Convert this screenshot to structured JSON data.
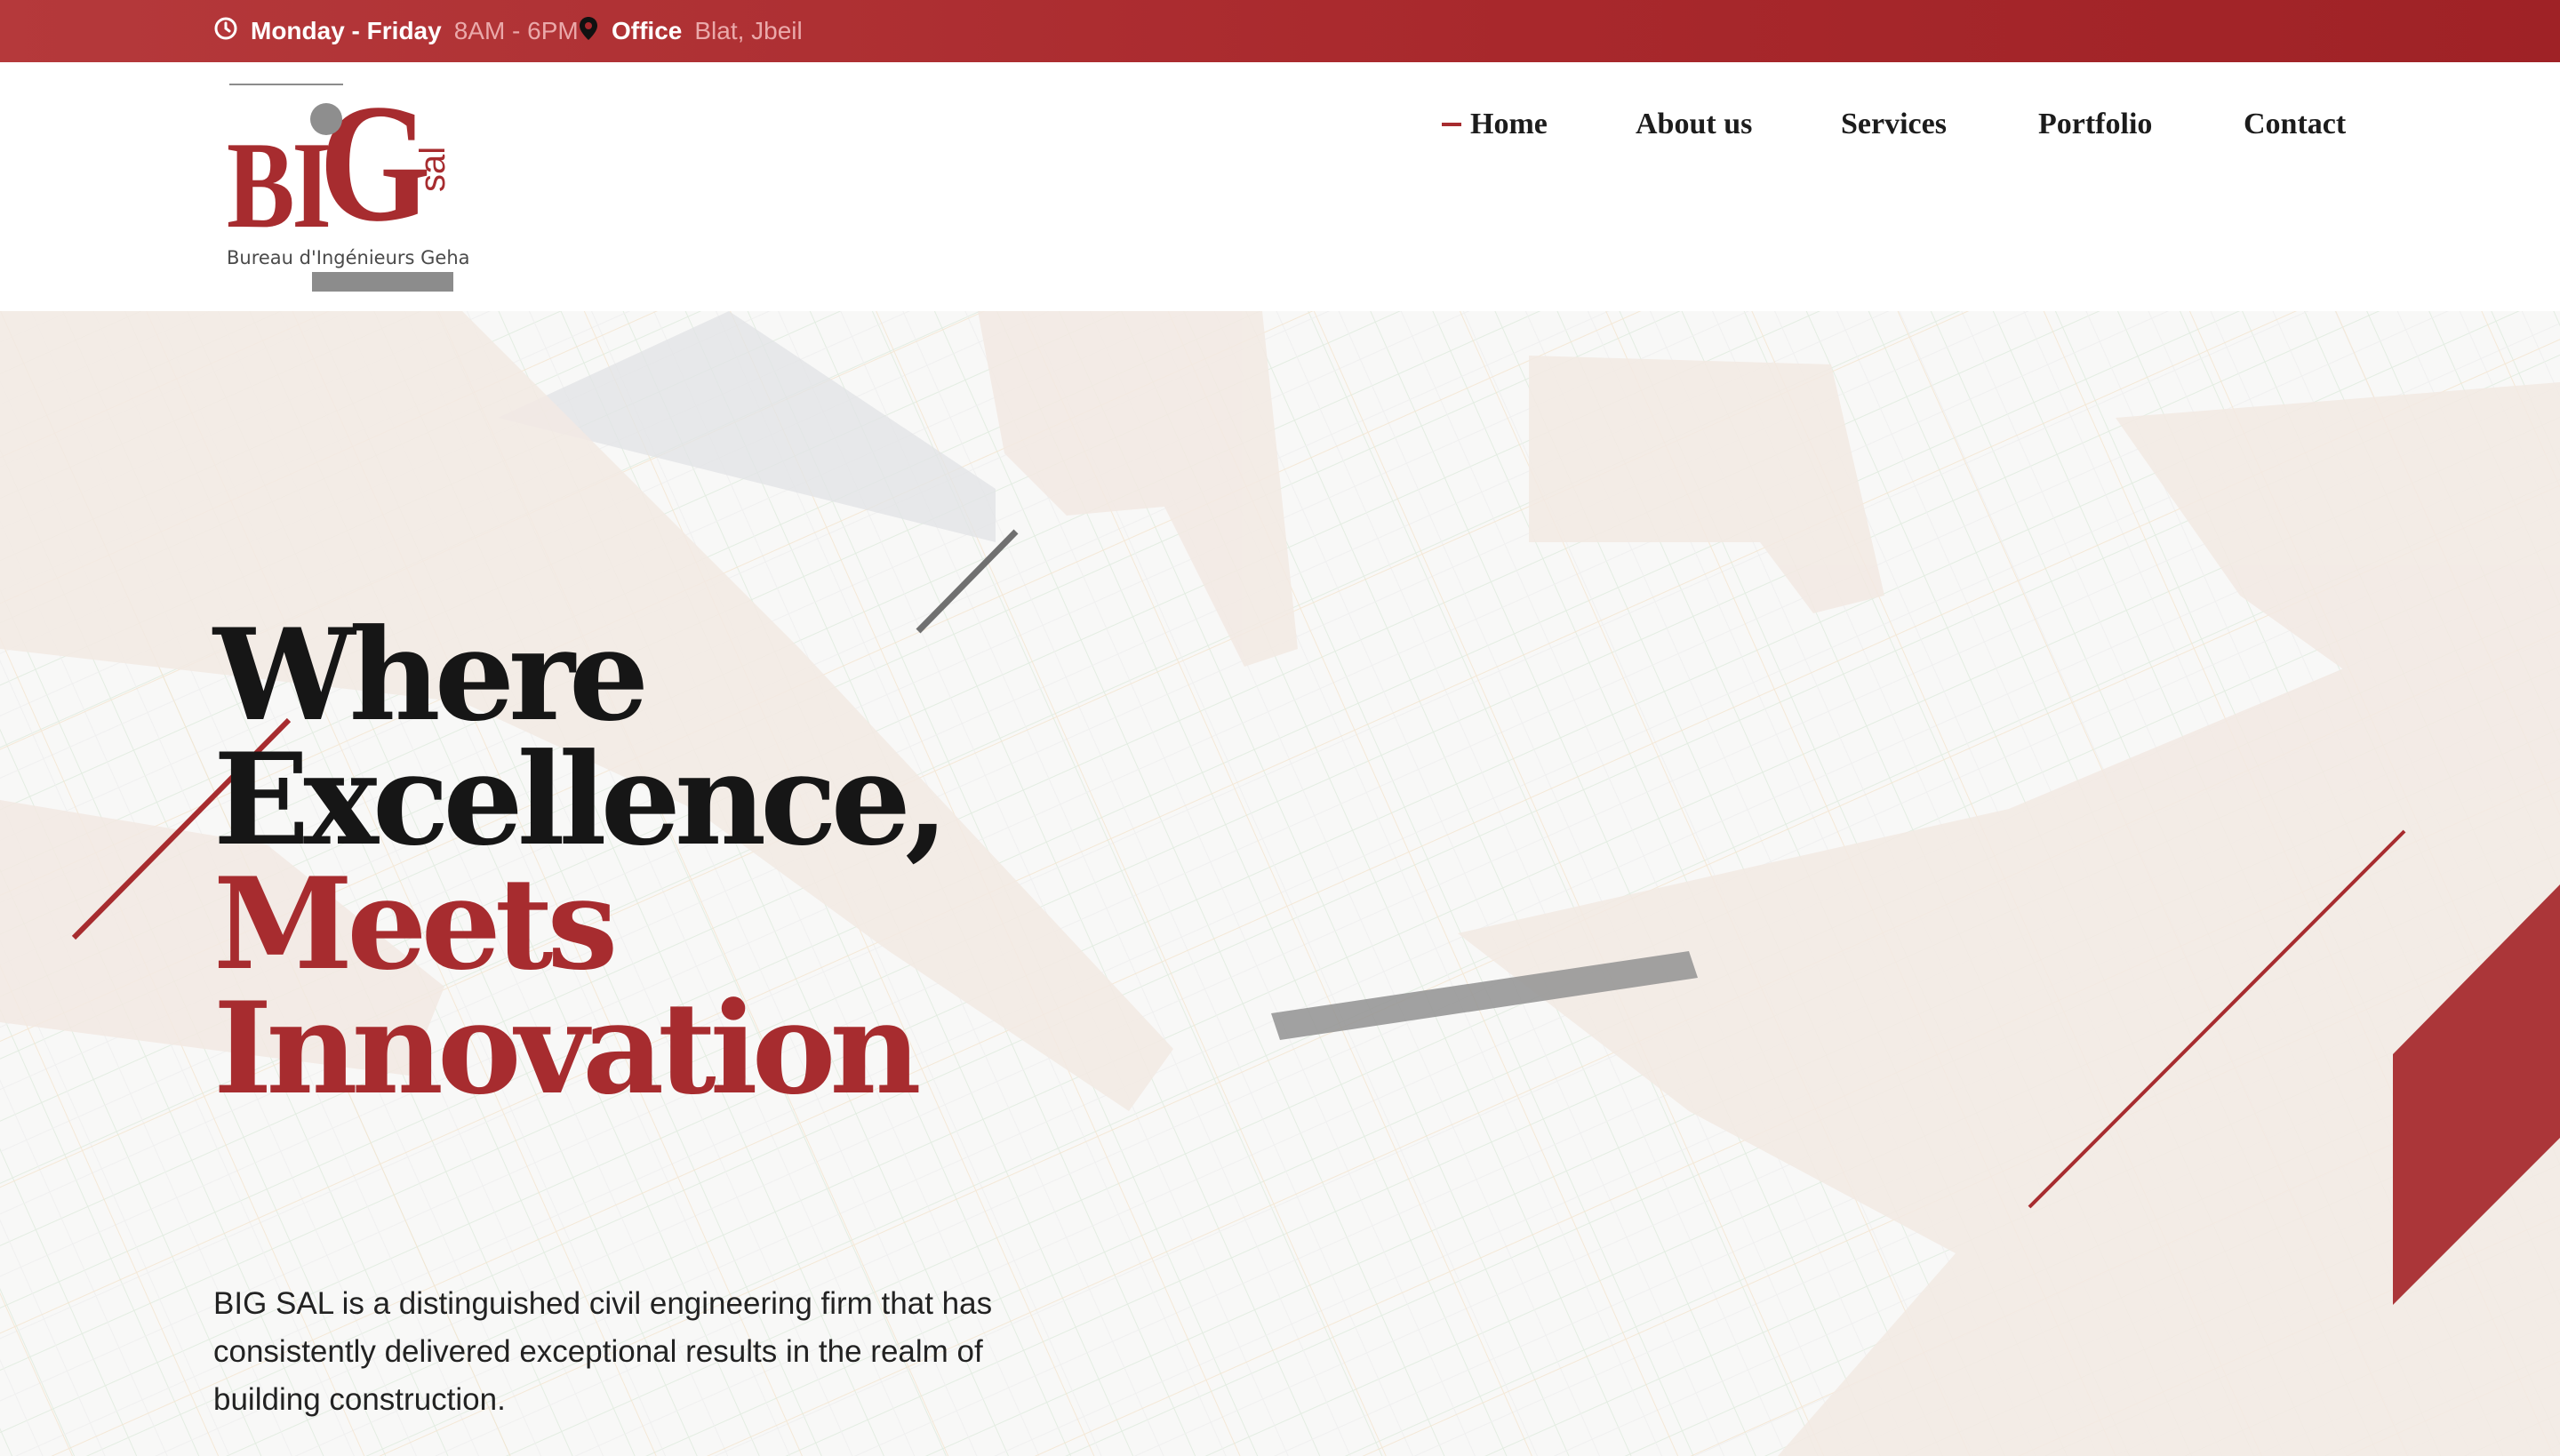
{
  "topbar": {
    "hours_label": "Monday - Friday",
    "hours_value": "8AM - 6PM",
    "office_label": "Office",
    "office_value": "Blat, Jbeil"
  },
  "logo": {
    "letters_bi": "BI",
    "letter_g": "G",
    "sal": "sal",
    "subtitle": "Bureau d'Ingénieurs Geha"
  },
  "nav": {
    "items": [
      {
        "label": "Home",
        "active": true
      },
      {
        "label": "About us",
        "active": false
      },
      {
        "label": "Services",
        "active": false
      },
      {
        "label": "Portfolio",
        "active": false
      },
      {
        "label": "Contact",
        "active": false
      }
    ]
  },
  "hero": {
    "title_line1": "Where",
    "title_line2": "Excellence,",
    "title_line3": "Meets",
    "title_line4": "Innovation",
    "description": "BIG SAL is a distinguished civil engineering firm that has consistently delivered exceptional results in the realm of building construction."
  },
  "colors": {
    "brand_red": "#a72c2f",
    "topbar_red": "#a8282c",
    "logo_gray": "#8c8c8c",
    "text_dark": "#161616"
  },
  "icons": {
    "hours": "clock-icon",
    "office": "map-pin-icon"
  }
}
